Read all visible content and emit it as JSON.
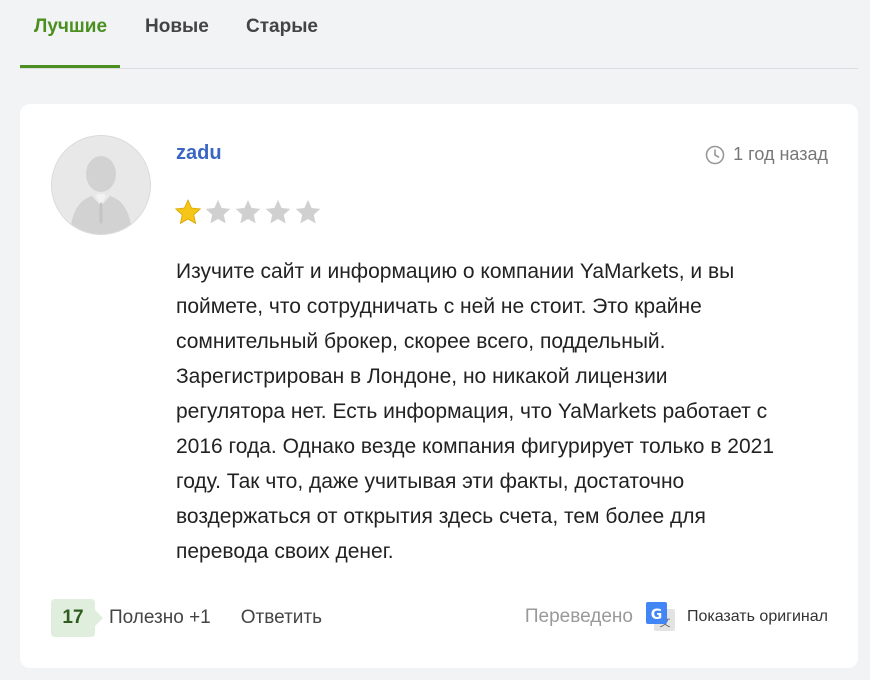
{
  "tabs": [
    {
      "label": "Лучшие",
      "active": true
    },
    {
      "label": "Новые",
      "active": false
    },
    {
      "label": "Старые",
      "active": false
    }
  ],
  "review": {
    "author": "zadu",
    "time": "1 год назад",
    "rating": 1,
    "rating_max": 5,
    "lines": [
      "Изучите сайт и информацию о компании YaMarkets, и вы",
      "поймете, что сотрудничать с ней не стоит. Это крайне",
      "сомнительный брокер, скорее всего, поддельный.",
      "Зарегистрирован в Лондоне, но никакой лицензии",
      "регулятора нет. Есть информация, что YaMarkets работает с",
      "2016 года. Однако везде компания фигурирует только в 2021",
      "году. Так что, даже учитывая эти факты, достаточно",
      "воздержаться от открытия здесь счета, тем более для",
      "перевода своих денег."
    ]
  },
  "footer": {
    "helpful_count": "17",
    "helpful_label": "Полезно +1",
    "reply_label": "Ответить",
    "translated_label": "Переведено",
    "show_original_label": "Показать оригинал"
  },
  "colors": {
    "accent": "#4a8f1f",
    "author": "#3a67c4",
    "star_filled": "#f5c518",
    "star_empty": "#d0d0d0",
    "badge_bg": "#dfeedd"
  },
  "icons": {
    "avatar": "default-user-silhouette",
    "time": "clock-icon",
    "translate": "google-translate-icon"
  }
}
